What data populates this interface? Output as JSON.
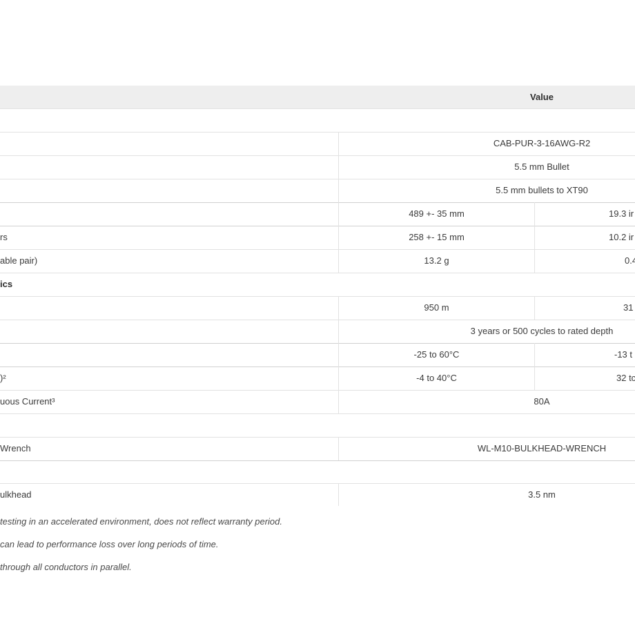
{
  "header": {
    "value_label": "Value"
  },
  "rows": [
    {
      "label": "",
      "value": ""
    },
    {
      "label": "",
      "value": "CAB-PUR-3-16AWG-R2"
    },
    {
      "label": "",
      "value": "5.5 mm Bullet"
    },
    {
      "label": "",
      "value": "5.5 mm bullets to XT90"
    },
    {
      "label": "",
      "metric": "489 +- 35 mm",
      "imperial": "19.3 ir"
    },
    {
      "label": "rs",
      "metric": "258 +- 15 mm",
      "imperial": "10.2 ir"
    },
    {
      "label": "able pair)",
      "metric": "13.2 g",
      "imperial": "0.4"
    },
    {
      "label": "ics",
      "value": ""
    },
    {
      "label": "",
      "metric": "950 m",
      "imperial": "31"
    },
    {
      "label": "",
      "value": "3 years or 500 cycles to rated depth"
    },
    {
      "label": "",
      "metric": "-25 to 60°C",
      "imperial": "-13 t"
    },
    {
      "label": ")²",
      "metric": "-4 to 40°C",
      "imperial": "32 tc"
    },
    {
      "label": "uous Current³",
      "value": "80A"
    },
    {
      "label": "",
      "value": ""
    },
    {
      "label": "Wrench",
      "value": "WL-M10-BULKHEAD-WRENCH"
    },
    {
      "label": "",
      "value": ""
    },
    {
      "label": "ulkhead",
      "value": "3.5 nm"
    }
  ],
  "footnotes": [
    "testing in an accelerated environment, does not reflect warranty period.",
    "can lead to performance loss over long periods of time.",
    "through all conductors in parallel."
  ]
}
